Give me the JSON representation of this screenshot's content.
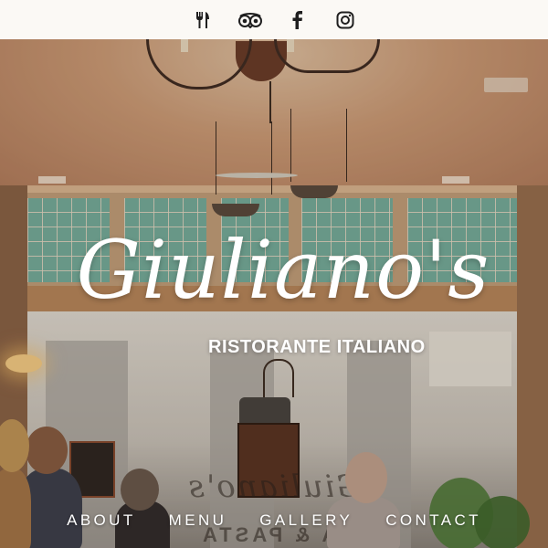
{
  "topbar": {
    "icons": [
      {
        "name": "fork-knife-icon",
        "label": ""
      },
      {
        "name": "tripadvisor-icon",
        "label": ""
      },
      {
        "name": "facebook-icon",
        "label": ""
      },
      {
        "name": "instagram-icon",
        "label": ""
      }
    ]
  },
  "hero": {
    "logo_script": "Giuliano's",
    "logo_subtitle": "RISTORANTE ITALIANO",
    "window_lettering_1": "Giuliano's",
    "window_lettering_2": "PIZZA & PASTA"
  },
  "nav": {
    "items": [
      "ABOUT",
      "MENU",
      "GALLERY",
      "CONTACT"
    ]
  },
  "colors": {
    "text": "#ffffff",
    "topbar_bg": "#fbf9f5",
    "icon": "#1f1f1f"
  }
}
